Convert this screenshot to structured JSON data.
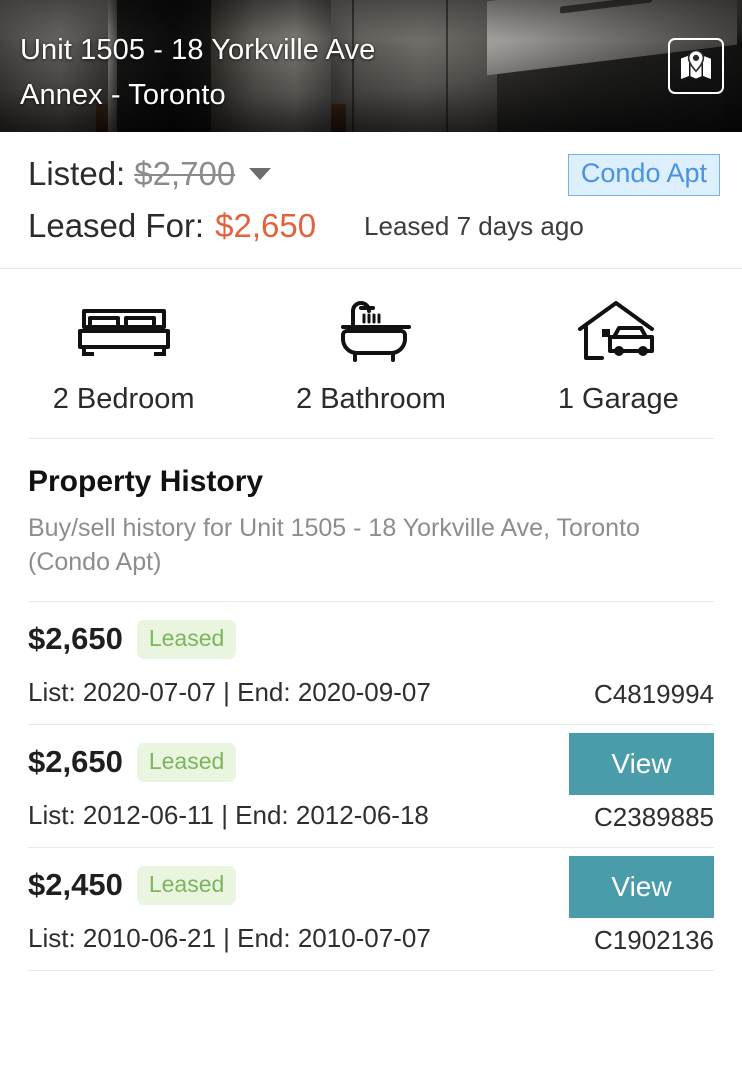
{
  "hero": {
    "title_line1": "Unit 1505 - 18 Yorkville Ave",
    "title_line2": "Annex - Toronto",
    "map_icon": "map-pin-icon"
  },
  "price": {
    "listed_label": "Listed:",
    "listed_price": "$2,700",
    "caret_icon": "chevron-down-icon",
    "leased_label": "Leased For:",
    "leased_price": "$2,650",
    "leased_ago": "Leased 7 days ago",
    "property_type": "Condo Apt",
    "accent_leased": "#e2623c",
    "badge_text_color": "#4a93e0",
    "badge_bg_color": "#ddeefc"
  },
  "stats": [
    {
      "label": "2 Bedroom",
      "icon": "bed-icon"
    },
    {
      "label": "2 Bathroom",
      "icon": "bathtub-shower-icon"
    },
    {
      "label": "1 Garage",
      "icon": "house-car-garage-icon"
    }
  ],
  "history": {
    "title": "Property History",
    "subtitle": "Buy/sell history for Unit 1505 - 18 Yorkville Ave, Toronto (Condo Apt)",
    "view_label": "View",
    "view_color": "#4a9caa",
    "status_color": "#7cb55c",
    "rows": [
      {
        "price": "$2,650",
        "status": "Leased",
        "dates": "List: 2020-07-07 | End: 2020-09-07",
        "mls": "C4819994",
        "has_view": false
      },
      {
        "price": "$2,650",
        "status": "Leased",
        "dates": "List: 2012-06-11 | End: 2012-06-18",
        "mls": "C2389885",
        "has_view": true
      },
      {
        "price": "$2,450",
        "status": "Leased",
        "dates": "List: 2010-06-21 | End: 2010-07-07",
        "mls": "C1902136",
        "has_view": true
      }
    ]
  }
}
